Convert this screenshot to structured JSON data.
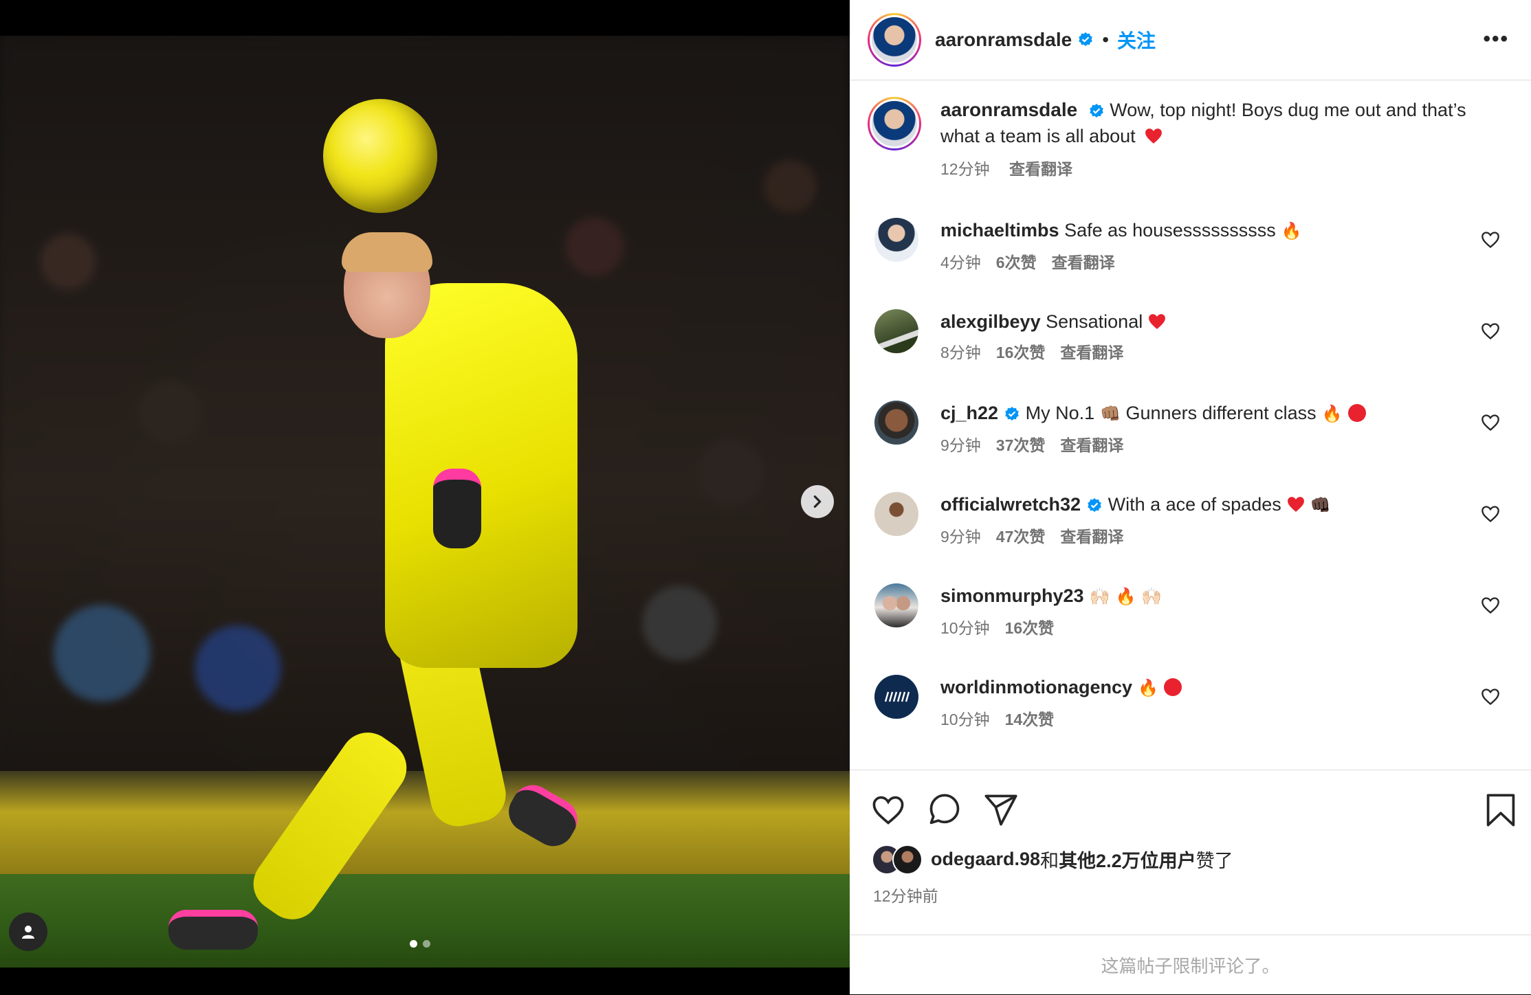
{
  "post": {
    "author": "aaronramsdale",
    "follow_label": "关注",
    "separator": "•",
    "more_label": "•••",
    "caption": "Wow, top night! Boys dug me out and that’s what a team is all about",
    "caption_time": "12分钟",
    "translate_label": "查看翻译",
    "slide_count": 2,
    "active_slide": 1
  },
  "comments": [
    {
      "user": "michaeltimbs",
      "verified": false,
      "text": "Safe as housessssssssss",
      "emojis": [
        "🔥"
      ],
      "time": "4分钟",
      "likes": "6次赞",
      "translate": "查看翻译",
      "avatar_color": "#e9eef5"
    },
    {
      "user": "alexgilbeyy",
      "verified": false,
      "text": "Sensational",
      "emojis": [
        "heart"
      ],
      "time": "8分钟",
      "likes": "16次赞",
      "translate": "查看翻译",
      "avatar_color": "#5b6b44"
    },
    {
      "user": "cj_h22",
      "verified": true,
      "text": "My No.1",
      "emojis": [
        "👊🏽"
      ],
      "text2": "Gunners different class",
      "emojis2": [
        "🔥",
        "red-circle"
      ],
      "time": "9分钟",
      "likes": "37次赞",
      "translate": "查看翻译",
      "avatar_color": "#3a4a55"
    },
    {
      "user": "officialwretch32",
      "verified": true,
      "text": "With a ace of spades",
      "emojis": [
        "heart",
        "👊🏿"
      ],
      "time": "9分钟",
      "likes": "47次赞",
      "translate": "查看翻译",
      "avatar_color": "#d8cfc2"
    },
    {
      "user": "simonmurphy23",
      "verified": false,
      "text": "",
      "emojis": [
        "🙌🏻",
        "🔥",
        "🙌🏻"
      ],
      "time": "10分钟",
      "likes": "16次赞",
      "translate": "",
      "avatar_color": "#4a7a9a"
    },
    {
      "user": "worldinmotionagency",
      "verified": false,
      "text": "",
      "emojis": [
        "🔥",
        "red-circle"
      ],
      "time": "10分钟",
      "likes": "14次赞",
      "translate": "",
      "avatar_color": "#0f2a4f"
    }
  ],
  "actions": {
    "like_icon": "heart-icon",
    "comment_icon": "comment-icon",
    "share_icon": "send-icon",
    "save_icon": "bookmark-icon"
  },
  "likes_summary": {
    "first_user": "odegaard.98",
    "connector": "和",
    "others": "其他2.2万位用户",
    "suffix": "赞了"
  },
  "posted_ago": "12分钟前",
  "comments_limited_note": "这篇帖子限制评论了。",
  "colors": {
    "accent": "#0095f6",
    "text": "#262626",
    "muted": "#737373",
    "heart": "#ff3040"
  }
}
